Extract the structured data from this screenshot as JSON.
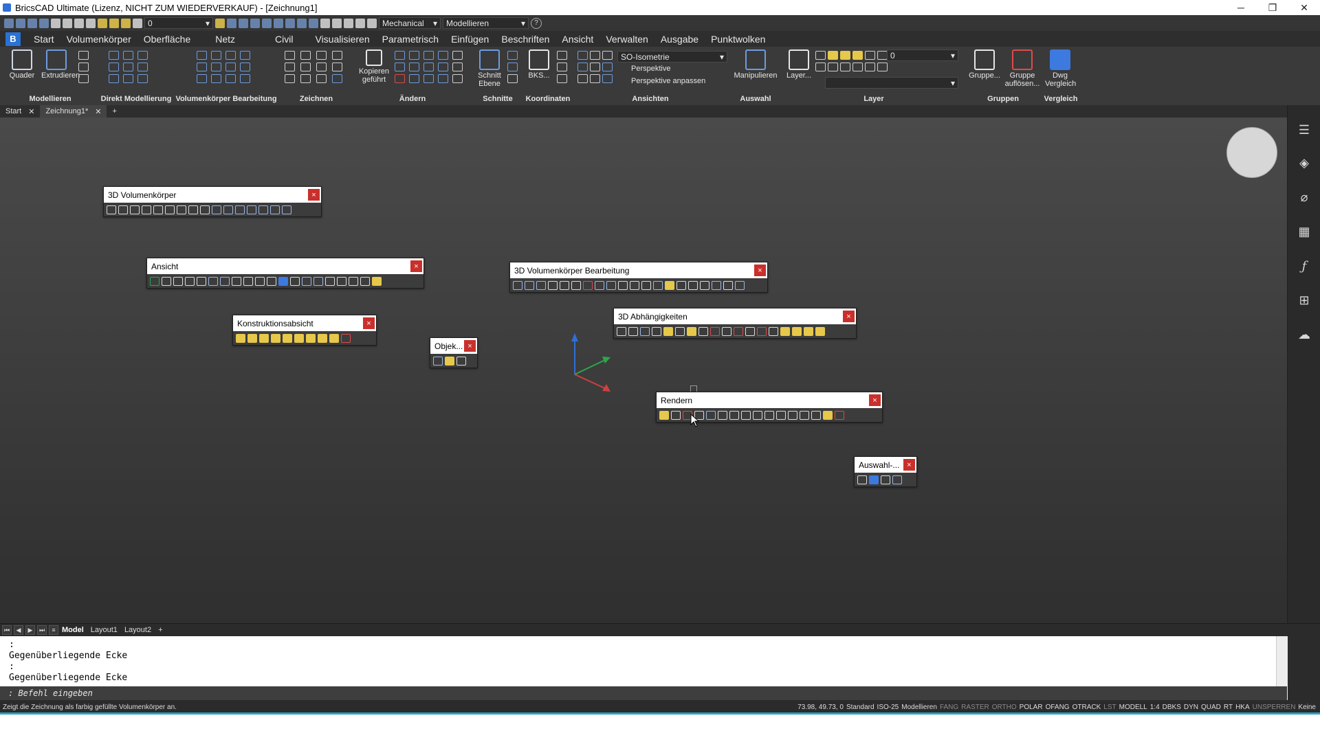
{
  "window": {
    "title": "BricsCAD Ultimate (Lizenz, NICHT ZUM WIEDERVERKAUF) - [Zeichnung1]",
    "minimize": "─",
    "restore": "❐",
    "close": "✕"
  },
  "qat": {
    "layer_value": "0",
    "workspace": "Mechanical",
    "mode": "Modellieren",
    "help": "?"
  },
  "menu": {
    "logo": "B",
    "items": [
      "Start",
      "Volumenkörper",
      "Oberfläche",
      "Netz",
      "Civil",
      "Visualisieren",
      "Parametrisch",
      "Einfügen",
      "Beschriften",
      "Ansicht",
      "Verwalten",
      "Ausgabe",
      "Punktwolken"
    ]
  },
  "ribbon": {
    "groups": [
      "Modellieren",
      "Direkt Modellierung",
      "Volumenkörper Bearbeitung",
      "Zeichnen",
      "Ändern",
      "Schnitte",
      "Koordinaten",
      "Ansichten",
      "Auswahl",
      "Layer",
      "Gruppen",
      "Vergleich"
    ],
    "buttons": {
      "quader": "Quader",
      "extrudieren": "Extrudieren",
      "kopieren": "Kopieren geführt",
      "schnitt": "Schnitt Ebene",
      "bks": "BKS...",
      "manipulieren": "Manipulieren",
      "layer": "Layer...",
      "gruppe": "Gruppe...",
      "gruppe_aufloesen": "Gruppe auflösen...",
      "dwg_vergleich": "Dwg Vergleich"
    },
    "views": {
      "iso": "SO-Isometrie",
      "perspektive": "Perspektive",
      "perspektive_anpassen": "Perspektive anpassen"
    },
    "layer_value": "0"
  },
  "doc_tabs": {
    "start": "Start",
    "drawing": "Zeichnung1*",
    "close": "✕",
    "add": "+",
    "more": "....."
  },
  "toolbars": {
    "volumenkoerper": "3D Volumenkörper",
    "ansicht": "Ansicht",
    "konstruktionsabsicht": "Konstruktionsabsicht",
    "objekt": "Objek...",
    "bearbeitung": "3D Volumenkörper Bearbeitung",
    "abhaengigkeiten": "3D Abhängigkeiten",
    "rendern": "Rendern",
    "auswahl": "Auswahl-...",
    "close": "×"
  },
  "layout": {
    "tabs": [
      "Model",
      "Layout1",
      "Layout2"
    ],
    "add": "+"
  },
  "command": {
    "history": [
      ":",
      "Gegenüberliegende Ecke",
      ":",
      "Gegenüberliegende Ecke"
    ],
    "prompt": ": Befehl eingeben"
  },
  "status": {
    "hint": "Zeigt die Zeichnung als farbig gefüllte Volumenkörper an.",
    "coords": "73.98, 49.73, 0",
    "items": [
      "Standard",
      "ISO-25",
      "Modellieren",
      "FANG",
      "RASTER",
      "ORTHO",
      "POLAR",
      "OFANG",
      "OTRACK",
      "LST",
      "MODELL",
      "1:4",
      "DBKS",
      "DYN",
      "QUAD",
      "RT",
      "HKA",
      "UNSPERREN",
      "Keine"
    ],
    "off": [
      "FANG",
      "RASTER",
      "ORTHO",
      "LST",
      "UNSPERREN"
    ]
  },
  "colors": {
    "accent": "#2f6fd6",
    "close_red": "#c9302c",
    "status_accent": "#29a3c7"
  }
}
